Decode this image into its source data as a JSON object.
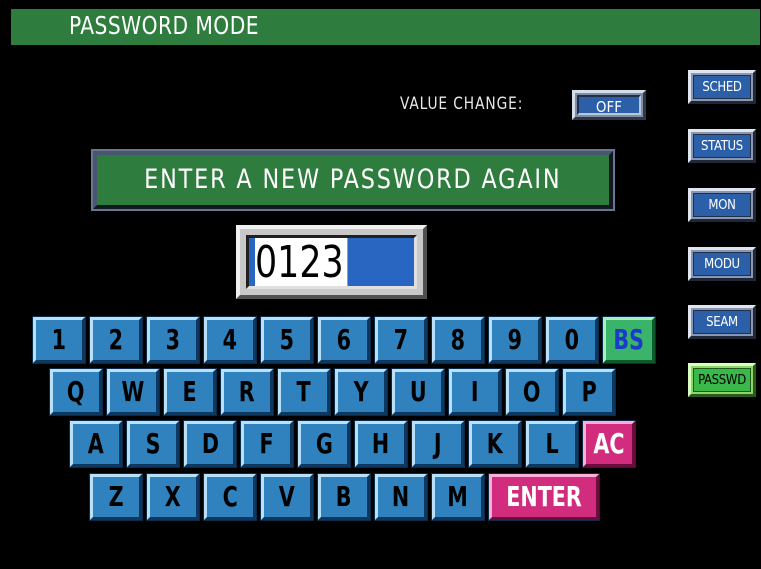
{
  "header": {
    "title": "PASSWORD MODE"
  },
  "value_change": {
    "label": "VALUE CHANGE:",
    "button": "OFF"
  },
  "prompt": "ENTER A NEW PASSWORD AGAIN",
  "password_field": {
    "value": "0123"
  },
  "keyboard": {
    "row1": [
      "1",
      "2",
      "3",
      "4",
      "5",
      "6",
      "7",
      "8",
      "9",
      "0"
    ],
    "bs": "BS",
    "row2": [
      "Q",
      "W",
      "E",
      "R",
      "T",
      "Y",
      "U",
      "I",
      "O",
      "P"
    ],
    "row3": [
      "A",
      "S",
      "D",
      "F",
      "G",
      "H",
      "J",
      "K",
      "L"
    ],
    "ac": "AC",
    "row4": [
      "Z",
      "X",
      "C",
      "V",
      "B",
      "N",
      "M"
    ],
    "enter": "ENTER"
  },
  "side_menu": [
    {
      "label": "SCHED",
      "active": false
    },
    {
      "label": "STATUS",
      "active": false
    },
    {
      "label": "MON",
      "active": false
    },
    {
      "label": "MODU",
      "active": false
    },
    {
      "label": "SEAM",
      "active": false
    },
    {
      "label": "PASSWD",
      "active": true
    }
  ],
  "colors": {
    "title_bar": "#2e7d3e",
    "key_blue": "#2f82bd",
    "key_green": "#3ab46a",
    "key_pink": "#d22c7e",
    "field_blue": "#2966c2"
  }
}
